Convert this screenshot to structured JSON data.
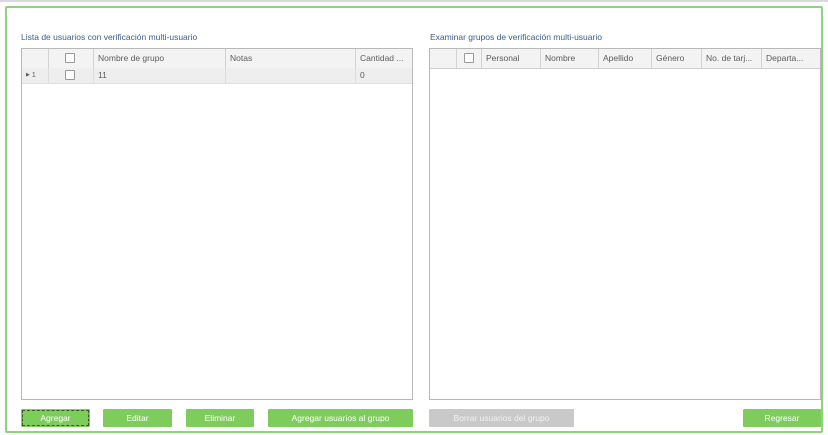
{
  "left_panel": {
    "title": "Lista de usuarios con verificación multi-usuario",
    "columns": [
      "",
      "Nombre de grupo",
      "Notas",
      "Cantidad ..."
    ],
    "rows": [
      {
        "index": "1",
        "group_name": "11",
        "notes": "",
        "quantity": "0",
        "selected": true
      }
    ]
  },
  "right_panel": {
    "title": "Examinar grupos de verificación multi-usuario",
    "columns": [
      "Personal",
      "Nombre",
      "Apellido",
      "Género",
      "No. de tarj...",
      "Departa..."
    ]
  },
  "buttons": {
    "add": "Agregar",
    "edit": "Editar",
    "delete": "Eliminar",
    "add_users": "Agregar usuarios al grupo",
    "remove_users": "Borrar usuarios del grupo",
    "back": "Regresar"
  },
  "colors": {
    "accent": "#7dcc5c",
    "frame": "#8fd27c",
    "title": "#3b5c8a",
    "disabled": "#c9c9c9"
  },
  "icons": {
    "row_marker": "play-triangle-icon",
    "checkbox": "checkbox-icon"
  }
}
